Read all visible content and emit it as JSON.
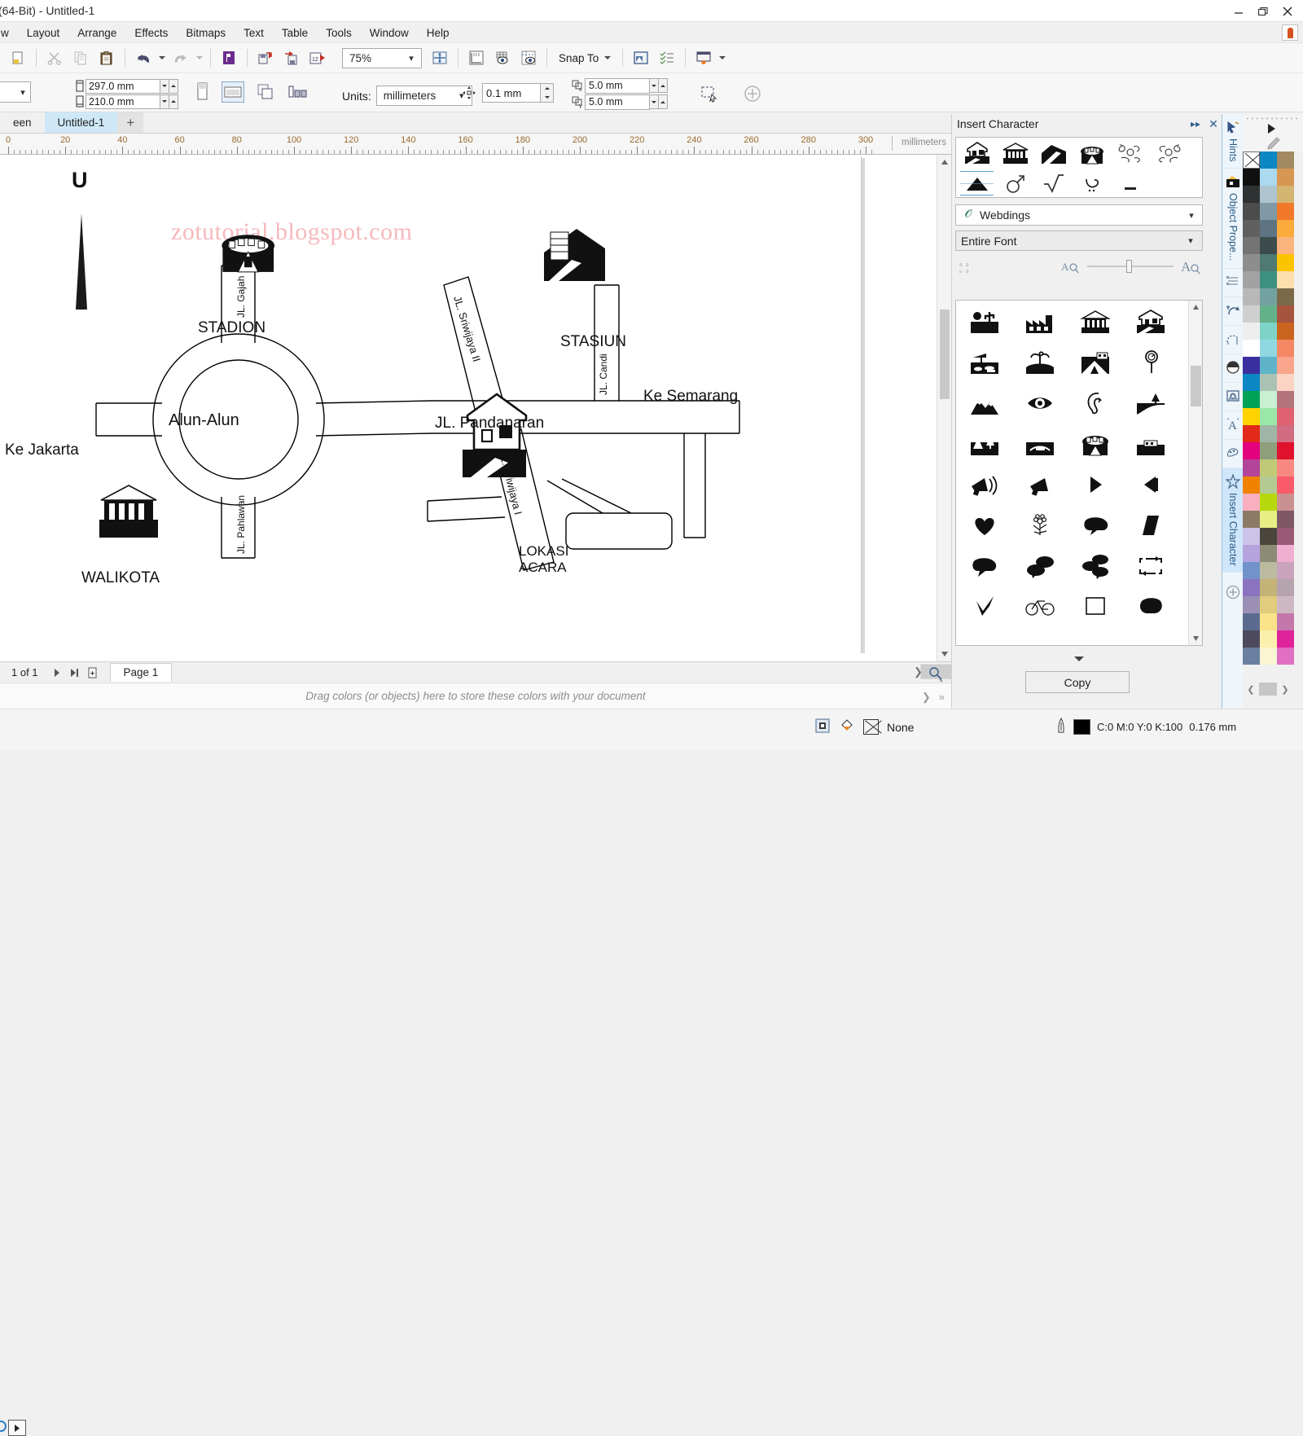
{
  "window": {
    "title": "(64-Bit) - Untitled-1",
    "minimize": "minimize-icon",
    "restore": "restore-icon",
    "close": "close-icon"
  },
  "menubar": {
    "items": [
      "w",
      "Layout",
      "Arrange",
      "Effects",
      "Bitmaps",
      "Text",
      "Table",
      "Tools",
      "Window",
      "Help"
    ]
  },
  "toolbar": {
    "zoom_level": "75%",
    "snap_to": "Snap To",
    "icons": [
      "cut-icon",
      "copy-icon",
      "paste-icon",
      "undo-icon",
      "redo-icon",
      "publish-pdf-icon",
      "import-icon",
      "export-icon",
      "export-to-icon",
      "fit-page-icon",
      "ruler-icon",
      "grid-icon",
      "guides-icon",
      "view-icon",
      "options-icon",
      "presets-icon"
    ]
  },
  "properties": {
    "page_width": "297.0 mm",
    "page_height": "210.0 mm",
    "units_label": "Units:",
    "units_value": "millimeters",
    "nudge": "0.1 mm",
    "duplicate_x": "5.0 mm",
    "duplicate_y": "5.0 mm"
  },
  "tabs": {
    "partial_left": "een",
    "selected": "Untitled-1",
    "add": "+"
  },
  "ruler": {
    "units": "millimeters",
    "ticks": [
      0,
      20,
      40,
      60,
      80,
      100,
      120,
      140,
      160,
      180,
      200,
      220,
      240,
      260,
      280,
      300
    ]
  },
  "canvas": {
    "watermark": "zotutorial.blogspot.com",
    "map": {
      "compass": "U",
      "labels": {
        "alun_alun": "Alun-Alun",
        "ke_jakarta": "Ke Jakarta",
        "ke_semarang": "Ke Semarang",
        "stadion": "STADION",
        "stasiun": "STASIUN",
        "walikota": "WALIKOTA",
        "jl_pandanaran": "JL. Pandanaran",
        "jl_gajah": "JL. Gajah",
        "jl_pahlawan": "JL. Pahlawan",
        "jl_sriwijaya_1": "JL. Sriwijaya I",
        "jl_sriwijaya_2": "JL. Sriwijaya II",
        "jl_candi": "JL. Candi",
        "lokasi_line1": "LOKASI",
        "lokasi_line2": "ACARA"
      }
    }
  },
  "pagenav": {
    "count": "1 of 1",
    "page_tab": "Page 1"
  },
  "palette_hint": "Drag colors (or objects) here to store these colors with your document",
  "statusbar": {
    "fill_label": "None",
    "outline_color": "C:0 M:0 Y:0 K:100",
    "outline_width": "0.176 mm"
  },
  "docker": {
    "title": "Insert Character",
    "font": "Webdings",
    "font_icon": "opentype-icon",
    "range": "Entire Font",
    "copy_button": "Copy",
    "recent_row1": [
      "house-on-land-icon",
      "museum-icon",
      "mountain-road-icon",
      "stadium-icon",
      "ornament-left-icon",
      "ornament-right-icon"
    ],
    "recent_row2": [
      "mountain-peak-icon",
      "mars-symbol-icon",
      "radical-sign-icon",
      "arabic-yeh-icon",
      "underscore-icon"
    ],
    "grid_icons": [
      [
        "person-cactus-icon",
        "factory-icon",
        "museum-icon",
        "house-on-land-icon"
      ],
      [
        "picnic-icon",
        "island-palm-icon",
        "tent-camp-icon",
        "magnifier-pin-icon"
      ],
      [
        "mountains-icon",
        "eye-icon",
        "ear-icon",
        "river-tree-icon"
      ],
      [
        "park-tree-icon",
        "bridge-car-icon",
        "stadium-icon",
        "boat-icon"
      ],
      [
        "megaphone-loud-icon",
        "megaphone-icon",
        "play-triangle-icon",
        "speaker-icon"
      ],
      [
        "heart-icon",
        "flower-bouquet-icon",
        "speech-cloud-icon",
        "parallelogram-icon"
      ],
      [
        "speech-bubble-icon",
        "two-bubbles-icon",
        "three-bubbles-icon",
        "refresh-frame-icon"
      ],
      [
        "checkmark-icon",
        "bicycle-icon",
        "square-outline-icon",
        "blob-icon"
      ]
    ]
  },
  "docker_tabs": [
    {
      "label": "Hints",
      "icon": "hints-icon",
      "active": false
    },
    {
      "label": "Object Prope...",
      "icon": "object-properties-icon",
      "active": false
    },
    {
      "label": "",
      "icon": "object-manager-icon",
      "active": false
    },
    {
      "label": "",
      "icon": "transformations-icon",
      "active": false
    },
    {
      "label": "",
      "icon": "shaping-icon",
      "active": false
    },
    {
      "label": "",
      "icon": "contour-icon",
      "active": false
    },
    {
      "label": "",
      "icon": "powerclip-icon",
      "active": false
    },
    {
      "label": "",
      "icon": "text-properties-icon",
      "active": false
    },
    {
      "label": "",
      "icon": "color-styles-icon",
      "active": false
    },
    {
      "label": "Insert Character",
      "icon": "star-icon",
      "active": true
    }
  ],
  "colors": {
    "accent_tab": "#cfe6fb",
    "selected_doc_tab": "#cfe8f8",
    "watermark": "#f6b9bc",
    "ruler_label": "#9a6a2e",
    "palette": [
      [
        "none",
        "#0b87c3",
        "#a38a63"
      ],
      [
        "#101010",
        "#abd9ef",
        "#d79651"
      ],
      [
        "#2f3232",
        "#aec4cf",
        "#d4b571"
      ],
      [
        "#4c4c4c",
        "#7f9aa6",
        "#f2792a"
      ],
      [
        "#5f5f5f",
        "#5e7482",
        "#fbab3c"
      ],
      [
        "#747474",
        "#3c4c4c",
        "#fbb47e"
      ],
      [
        "#8d8d8d",
        "#4f7a72",
        "#fcc400"
      ],
      [
        "#a2a2a2",
        "#3d9181",
        "#fddfae"
      ],
      [
        "#b8b8b8",
        "#74a2a0",
        "#7a6a4a"
      ],
      [
        "#cfcfcf",
        "#64b089",
        "#a7543e"
      ],
      [
        "#eeeeee",
        "#7ed3c8",
        "#c9641f"
      ],
      [
        "#ffffff",
        "#8fd8e2",
        "#f58763"
      ],
      [
        "#3b2fa0",
        "#5eb3c9",
        "#f9a48b"
      ],
      [
        "#0b87c3",
        "#a9c2b4",
        "#fbd4c4"
      ],
      [
        "#00a256",
        "#c9f0d0",
        "#b2737b"
      ],
      [
        "#ffd200",
        "#9ae7a9",
        "#e0616f"
      ],
      [
        "#e12a17",
        "#9fb6a6",
        "#d16c81"
      ],
      [
        "#e4007f",
        "#8f9f7c",
        "#e0112d"
      ],
      [
        "#b2459a",
        "#c0c977",
        "#f98880"
      ],
      [
        "#f08200",
        "#b3ca93",
        "#f95b6a"
      ],
      [
        "#f9afc0",
        "#b6d80d",
        "#c99090"
      ],
      [
        "#8c7a66",
        "#e7ee83",
        "#7d5763"
      ],
      [
        "#cdc3e8",
        "#4a463c",
        "#9a5a76"
      ],
      [
        "#b5a3dd",
        "#8b8b76",
        "#f0aed0"
      ],
      [
        "#7193c9",
        "#bcbba0",
        "#c9a2bb"
      ],
      [
        "#8c73c0",
        "#c4b277",
        "#b5a3ae"
      ],
      [
        "#9b8fb5",
        "#e0cc7c",
        "#cdb7c2"
      ],
      [
        "#5b6b90",
        "#fbe38a",
        "#c377ab"
      ],
      [
        "#4d4a5e",
        "#fcefae",
        "#e0239b"
      ],
      [
        "#6b7fa0",
        "#fbf5d3",
        "#e06ec2"
      ]
    ]
  }
}
